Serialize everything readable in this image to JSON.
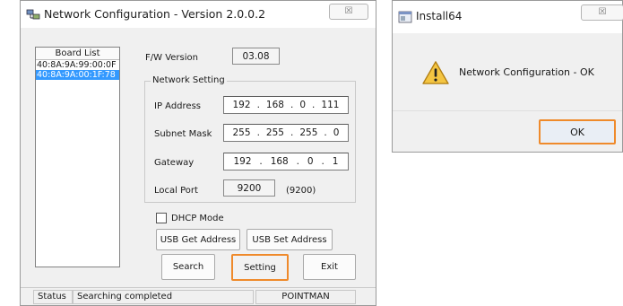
{
  "main_window": {
    "title": "Network Configuration - Version 2.0.0.2",
    "close_glyph": "☒",
    "board_list": {
      "header": "Board List",
      "items": [
        {
          "mac": "40:8A:9A:99:00:0F",
          "selected": false
        },
        {
          "mac": "40:8A:9A:00:1F:78",
          "selected": true
        }
      ]
    },
    "fw_version": {
      "label": "F/W Version",
      "value": "03.08"
    },
    "network_setting": {
      "group_label": "Network Setting",
      "ip_address": {
        "label": "IP Address",
        "octets": [
          "192",
          "168",
          "0",
          "111"
        ]
      },
      "subnet_mask": {
        "label": "Subnet Mask",
        "octets": [
          "255",
          "255",
          "255",
          "0"
        ]
      },
      "gateway": {
        "label": "Gateway",
        "octets": [
          "192",
          "168",
          "0",
          "1"
        ]
      },
      "local_port": {
        "label": "Local Port",
        "value": "9200",
        "hint": "(9200)"
      }
    },
    "dhcp_mode": {
      "label": "DHCP Mode",
      "checked": false
    },
    "buttons": {
      "usb_get": "USB Get Address",
      "usb_set": "USB Set Address",
      "search": "Search",
      "setting": "Setting",
      "exit": "Exit"
    },
    "status_bar": {
      "label": "Status",
      "message": "Searching completed",
      "brand": "POINTMAN"
    },
    "highlight_color": "#ef8a2b"
  },
  "dialog": {
    "title": "Install64",
    "close_glyph": "☒",
    "message": "Network Configuration - OK",
    "icon": "warning-icon",
    "ok_label": "OK"
  }
}
